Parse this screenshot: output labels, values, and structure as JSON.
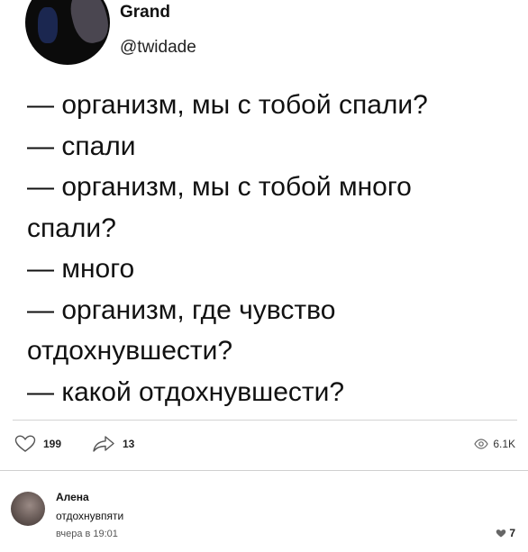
{
  "post": {
    "author_name": "Grand",
    "author_handle": "@twidade",
    "lines": [
      "— организм, мы с тобой спали?",
      "— спали",
      "— организм, мы с тобой много",
      "спали?",
      "— много",
      "— организм, где чувство",
      "отдохнувшести?",
      "— какой отдохнувшести?"
    ],
    "likes": "199",
    "shares": "13",
    "views": "6.1K",
    "icons": {
      "like": "heart-icon",
      "share": "share-arrow-icon",
      "views": "eye-icon"
    }
  },
  "comment": {
    "author": "Алена",
    "text": "отдохнувпяти",
    "time": "вчера в 19:01",
    "likes": "7",
    "like_icon": "heart-filled-icon"
  }
}
